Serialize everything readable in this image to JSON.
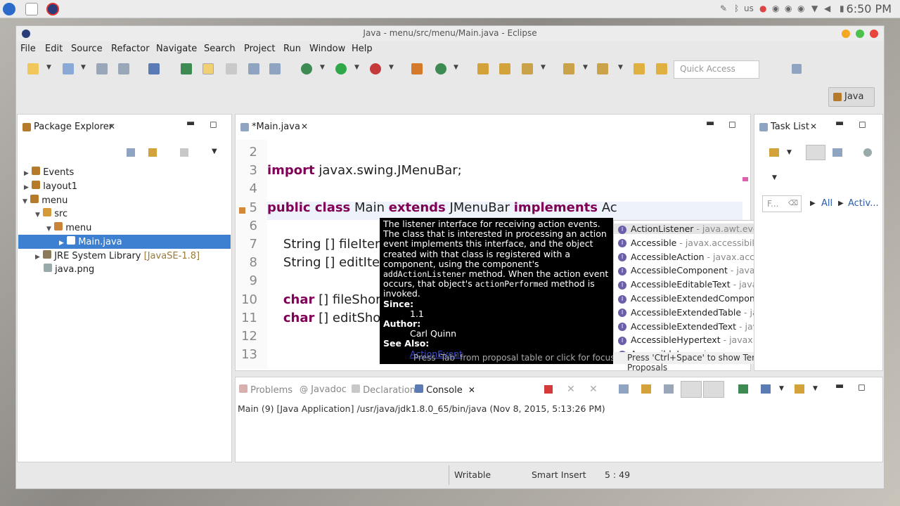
{
  "desktop": {
    "time": "6:50 PM",
    "keyboard": "us"
  },
  "window": {
    "title": "Java - menu/src/menu/Main.java - Eclipse"
  },
  "menubar": [
    "File",
    "Edit",
    "Source",
    "Refactor",
    "Navigate",
    "Search",
    "Project",
    "Run",
    "Window",
    "Help"
  ],
  "toolbar": {
    "quick_access_placeholder": "Quick Access",
    "perspective": "Java"
  },
  "package_explorer": {
    "tab": "Package Explorer",
    "items": [
      {
        "label": "Events",
        "depth": 0
      },
      {
        "label": "layout1",
        "depth": 0
      },
      {
        "label": "menu",
        "depth": 0
      },
      {
        "label": "src",
        "depth": 1
      },
      {
        "label": "menu",
        "depth": 2
      },
      {
        "label": "Main.java",
        "depth": 3
      },
      {
        "label": "JRE System Library",
        "extra": "[JavaSE-1.8]",
        "depth": 1
      },
      {
        "label": "java.png",
        "depth": 1
      }
    ]
  },
  "editor": {
    "tab": "*Main.java",
    "lines": [
      {
        "n": "2",
        "parts": []
      },
      {
        "n": "3",
        "parts": [
          {
            "t": "import",
            "kw": true
          },
          {
            "t": " javax.swing.JMenuBar;"
          }
        ]
      },
      {
        "n": "4",
        "parts": []
      },
      {
        "n": "5",
        "parts": [
          {
            "t": "public class",
            "kw": true
          },
          {
            "t": " Main "
          },
          {
            "t": "extends",
            "kw": true
          },
          {
            "t": " JMenuBar "
          },
          {
            "t": "implements",
            "kw": true
          },
          {
            "t": " Ac"
          }
        ]
      },
      {
        "n": "6",
        "parts": []
      },
      {
        "n": "7",
        "parts": [
          {
            "t": "    String [] fileItem"
          }
        ]
      },
      {
        "n": "8",
        "parts": [
          {
            "t": "    String [] editIter"
          }
        ]
      },
      {
        "n": "9",
        "parts": []
      },
      {
        "n": "10",
        "parts": [
          {
            "t": "    "
          },
          {
            "t": "char",
            "kw": true
          },
          {
            "t": " [] fileShort"
          }
        ]
      },
      {
        "n": "11",
        "parts": [
          {
            "t": "    "
          },
          {
            "t": "char",
            "kw": true
          },
          {
            "t": " [] editShor"
          }
        ]
      },
      {
        "n": "12",
        "parts": []
      },
      {
        "n": "13",
        "parts": []
      }
    ]
  },
  "javadoc": {
    "text1": "The listener interface for receiving action events. The class that is interested in processing an action event implements this interface, and the object created with that class is registered with a component, using the component's",
    "code1": "addActionListener",
    "text2": " method. When the action event occurs, that object's ",
    "code2": "actionPerformed",
    "text3": " method is invoked.",
    "since_label": "Since:",
    "since": "1.1",
    "author_label": "Author:",
    "author": "Carl Quinn",
    "see_label": "See Also:",
    "see": "ActionEvent",
    "hint": "Press 'Tab' from proposal table or click for focus"
  },
  "proposals": {
    "items": [
      {
        "name": "ActionListener",
        "pkg": " - java.awt.event"
      },
      {
        "name": "Accessible",
        "pkg": " - javax.accessibility"
      },
      {
        "name": "AccessibleAction",
        "pkg": " - javax.accessibility"
      },
      {
        "name": "AccessibleComponent",
        "pkg": " - javax.accessibility"
      },
      {
        "name": "AccessibleEditableText",
        "pkg": " - javax.accessibility"
      },
      {
        "name": "AccessibleExtendedComponent",
        "pkg": " - javax.access"
      },
      {
        "name": "AccessibleExtendedTable",
        "pkg": " - javax.accessibility"
      },
      {
        "name": "AccessibleExtendedText",
        "pkg": " - javax.accessibility"
      },
      {
        "name": "AccessibleHypertext",
        "pkg": " - javax.accessibility"
      },
      {
        "name": "AccessibleIcon",
        "pkg": " - javax.accessibility"
      }
    ],
    "footer": "Press 'Ctrl+Space' to show Template Proposals"
  },
  "task_list": {
    "tab": "Task List",
    "filter_placeholder": "F...",
    "all": "All",
    "activate": "Activ..."
  },
  "bottom": {
    "tabs": [
      "Problems",
      "Javadoc",
      "Declaration",
      "Console"
    ],
    "console_line": "Main (9) [Java Application] /usr/java/jdk1.8.0_65/bin/java (Nov 8, 2015, 5:13:26 PM)"
  },
  "status": {
    "writable": "Writable",
    "insert": "Smart Insert",
    "position": "5 : 49"
  },
  "colors": {
    "keyword": "#7f0055",
    "selection": "#3d7fd1",
    "tooltip_bg": "#000000"
  }
}
